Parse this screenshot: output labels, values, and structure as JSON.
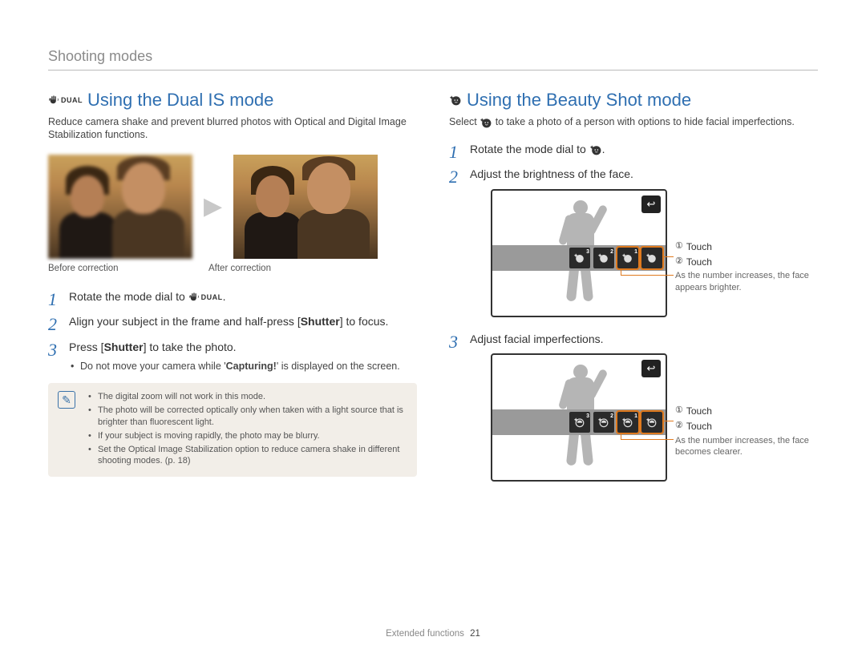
{
  "header": {
    "title": "Shooting modes"
  },
  "footer": {
    "section": "Extended functions",
    "page": "21"
  },
  "left": {
    "title": "Using the Dual IS mode",
    "intro": "Reduce camera shake and prevent blurred photos with Optical and Digital Image Stabilization functions.",
    "caption_before": "Before correction",
    "caption_after": "After correction",
    "steps": {
      "s1": "Rotate the mode dial to ",
      "s1_suffix": ".",
      "s2_a": "Align your subject in the frame and half-press [",
      "s2_b": "Shutter",
      "s2_c": "] to focus.",
      "s3_a": "Press [",
      "s3_b": "Shutter",
      "s3_c": "] to take the photo.",
      "s3_sub_a": "Do not move your camera while '",
      "s3_sub_b": "Capturing!",
      "s3_sub_c": "' is displayed on the screen."
    },
    "notes": [
      "The digital zoom will not work in this mode.",
      "The photo will be corrected optically only when taken with a light source that is brighter than fluorescent light.",
      "If your subject is moving rapidly, the photo may be blurry.",
      "Set the Optical Image Stabilization option to reduce camera shake in different shooting modes. (p. 18)"
    ],
    "icon_label": "DUAL"
  },
  "right": {
    "title": "Using the Beauty Shot mode",
    "intro_a": "Select ",
    "intro_b": " to take a photo of a person with options to hide facial imperfections.",
    "steps": {
      "s1": "Rotate the mode dial to ",
      "s1_suffix": ".",
      "s2": "Adjust the brightness of the face.",
      "s3": "Adjust facial imperfections."
    },
    "legend1": {
      "l1_num": "①",
      "l1_text": "Touch",
      "l2_num": "②",
      "l2_text": "Touch",
      "note": "As the number increases, the face appears brighter."
    },
    "legend2": {
      "l1_num": "①",
      "l1_text": "Touch",
      "l2_num": "②",
      "l2_text": "Touch",
      "note": "As the number increases, the face becomes clearer."
    },
    "tool_badges": {
      "b3": "3",
      "b2": "2",
      "b1": "1"
    }
  }
}
